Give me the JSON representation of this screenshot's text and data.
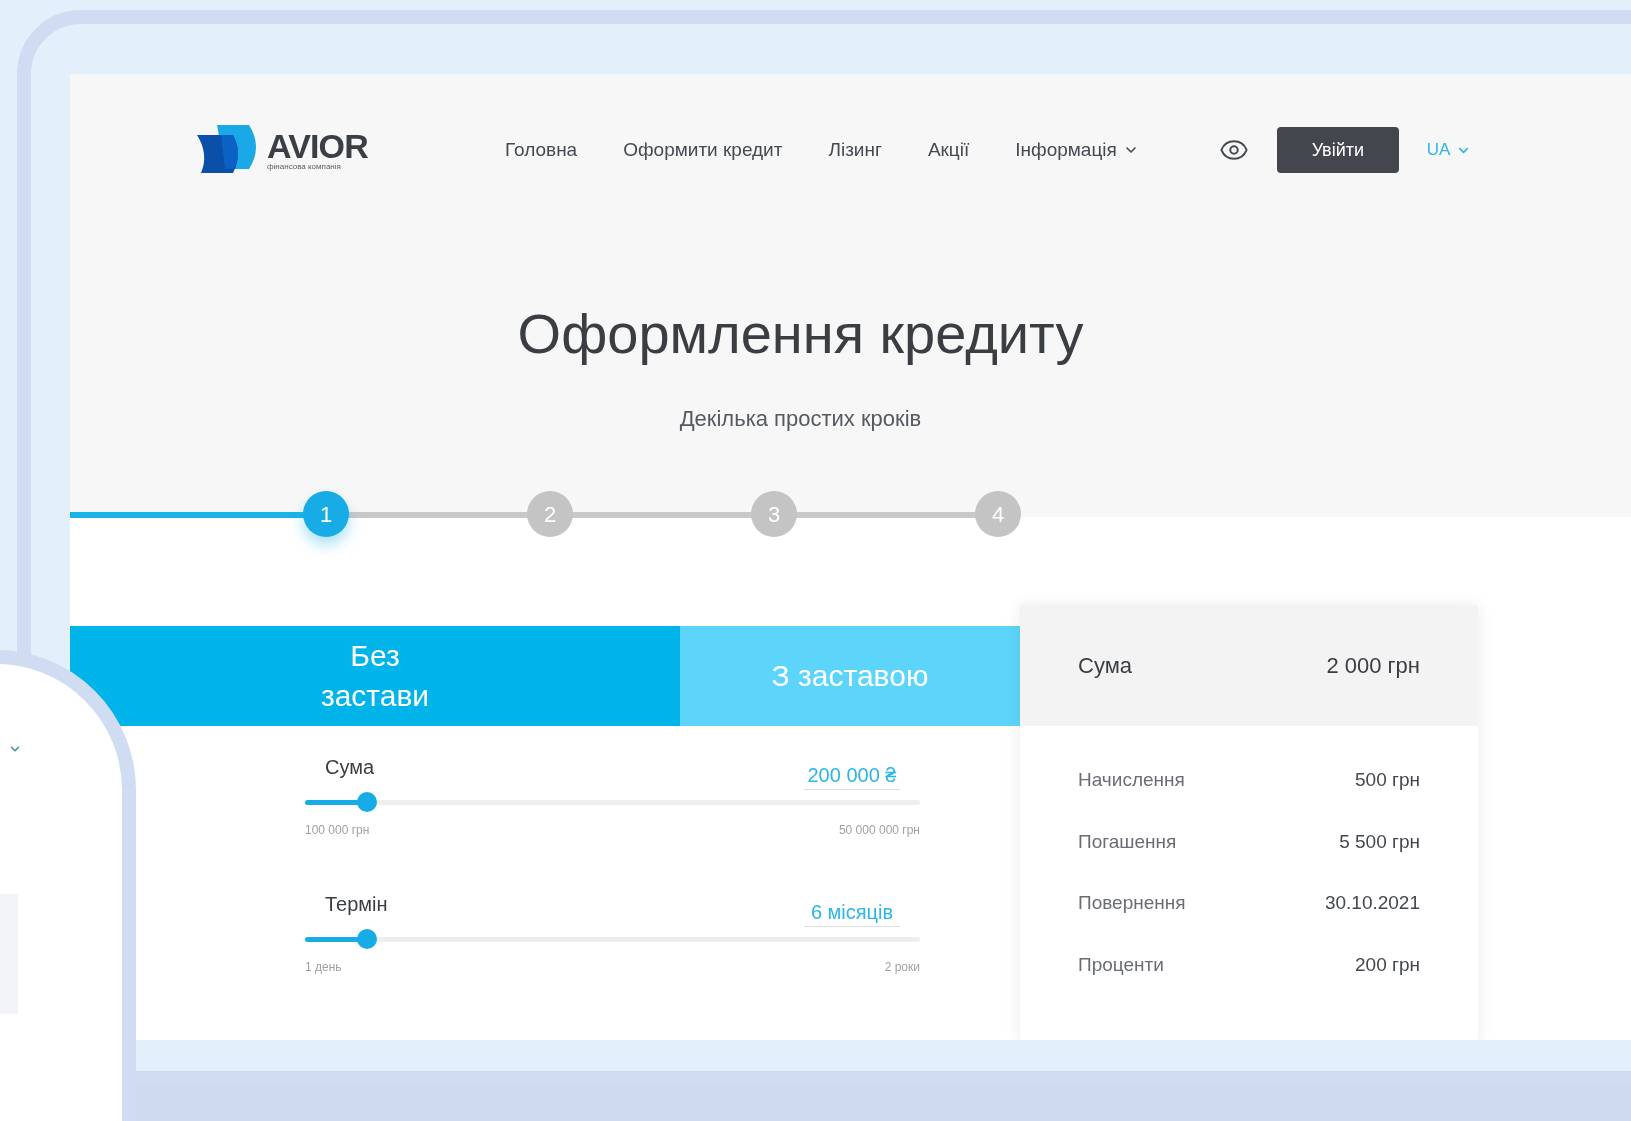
{
  "header": {
    "logo": {
      "name": "AVIOR",
      "tagline": "фінансова компанія"
    },
    "nav": [
      {
        "label": "Головна",
        "has_dropdown": false
      },
      {
        "label": "Оформити кредит",
        "has_dropdown": false
      },
      {
        "label": "Лізинг",
        "has_dropdown": false
      },
      {
        "label": "Акції",
        "has_dropdown": false
      },
      {
        "label": "Інформація",
        "has_dropdown": true
      }
    ],
    "login_button": "Увійти",
    "language": "UA"
  },
  "hero": {
    "title": "Оформлення кредиту",
    "subtitle": "Декілька простих кроків"
  },
  "steps": [
    {
      "label": "1",
      "selected": true
    },
    {
      "label": "2",
      "selected": false
    },
    {
      "label": "3",
      "selected": false
    },
    {
      "label": "4",
      "selected": false
    }
  ],
  "tabs": [
    {
      "label": "Без застави",
      "selected": true
    },
    {
      "label": "З заставою",
      "selected": false
    }
  ],
  "sliders": [
    {
      "label": "Сума",
      "value": "200 000 ₴",
      "level": 0.1,
      "min_label": "100 000 грн",
      "max_label": "50 000 000 грн"
    },
    {
      "label": "Термін",
      "value": "6 місяців",
      "level": 0.1,
      "min_label": "1 день",
      "max_label": "2 роки"
    }
  ],
  "summary": {
    "label": "Сума",
    "value": "2 000 грн",
    "rows": [
      {
        "label": "Начислення",
        "value": "500 грн"
      },
      {
        "label": "Погашення",
        "value": "5 500 грн"
      },
      {
        "label": "Повернення",
        "value": "30.10.2021"
      },
      {
        "label": "Проценти",
        "value": "200 грн"
      }
    ]
  }
}
